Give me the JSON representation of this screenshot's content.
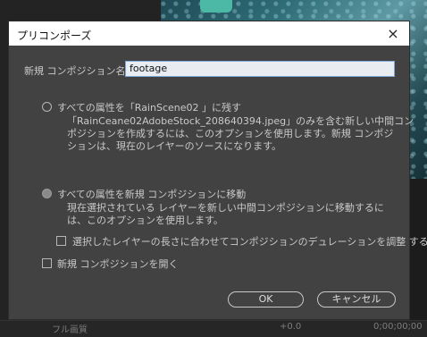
{
  "dialog": {
    "title": "プリコンポーズ",
    "name_label": "新規 コンポジション名：",
    "name_value": "footage",
    "option1": {
      "label": "すべての属性を「RainScene02 」に残す",
      "desc_line1": "「RainCeane02AdobeStock_208640394.jpeg」のみを含む新しい中間コン",
      "desc_line2": "ポジションを作成するには、このオプションを使用します。新規 コンポジ",
      "desc_line3": "ションは、現在のレイヤーのソースになります。"
    },
    "option2": {
      "label": "すべての属性を新規 コンポジションに移動",
      "desc_line1": "現在選択されている レイヤーを新しい中間コンポジションに移動するに",
      "desc_line2": "は、このオプションを使用します。"
    },
    "adjust_duration_label": "選択したレイヤーの長さに合わせてコンポジションのデュレーションを調整 する",
    "open_comp_label": "新規 コンポジションを開く",
    "ok_label": "OK",
    "cancel_label": "キャンセル",
    "close_icon": "×"
  },
  "background": {
    "zoom_label": "フル画質",
    "exposure_label": "+0.0",
    "timecode": "0;00;00;00"
  }
}
